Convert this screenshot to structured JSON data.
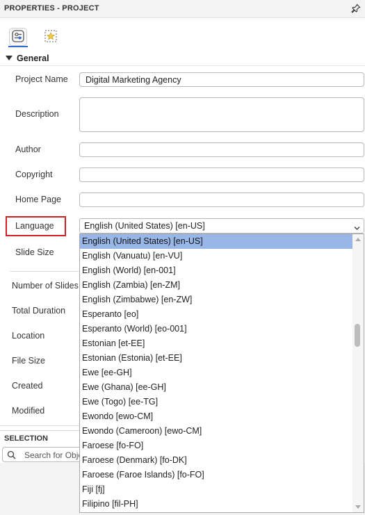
{
  "panel": {
    "title": "PROPERTIES - PROJECT",
    "pin_icon": "pin-icon"
  },
  "tabs": [
    {
      "name": "properties-tab",
      "icon": "sliders-icon",
      "active": true
    },
    {
      "name": "style-tab",
      "icon": "star-frame-icon",
      "active": false
    }
  ],
  "section": {
    "label": "General"
  },
  "fields": {
    "project_name": {
      "label": "Project Name",
      "value": "Digital Marketing Agency"
    },
    "description": {
      "label": "Description",
      "value": ""
    },
    "author": {
      "label": "Author",
      "value": ""
    },
    "copyright": {
      "label": "Copyright",
      "value": ""
    },
    "home_page": {
      "label": "Home Page",
      "value": ""
    },
    "language": {
      "label": "Language",
      "value": "English (United States) [en-US]"
    },
    "slide_size": {
      "label": "Slide Size"
    }
  },
  "info_labels": {
    "number_of_slides": "Number of Slides",
    "total_duration": "Total Duration",
    "location": "Location",
    "file_size": "File Size",
    "created": "Created",
    "modified": "Modified"
  },
  "selection": {
    "label": "SELECTION",
    "search_placeholder": "Search for Obje"
  },
  "language_options": [
    "English (United States) [en-US]",
    "English (Vanuatu) [en-VU]",
    "English (World) [en-001]",
    "English (Zambia) [en-ZM]",
    "English (Zimbabwe) [en-ZW]",
    "Esperanto [eo]",
    "Esperanto (World) [eo-001]",
    "Estonian [et-EE]",
    "Estonian (Estonia) [et-EE]",
    "Ewe [ee-GH]",
    "Ewe (Ghana) [ee-GH]",
    "Ewe (Togo) [ee-TG]",
    "Ewondo [ewo-CM]",
    "Ewondo (Cameroon) [ewo-CM]",
    "Faroese [fo-FO]",
    "Faroese (Denmark) [fo-DK]",
    "Faroese (Faroe Islands) [fo-FO]",
    "Fiji [fj]",
    "Filipino [fil-PH]"
  ],
  "colors": {
    "highlight_border": "#d11f24",
    "selected_item": "#98b7e8",
    "accent": "#2b6fce"
  }
}
